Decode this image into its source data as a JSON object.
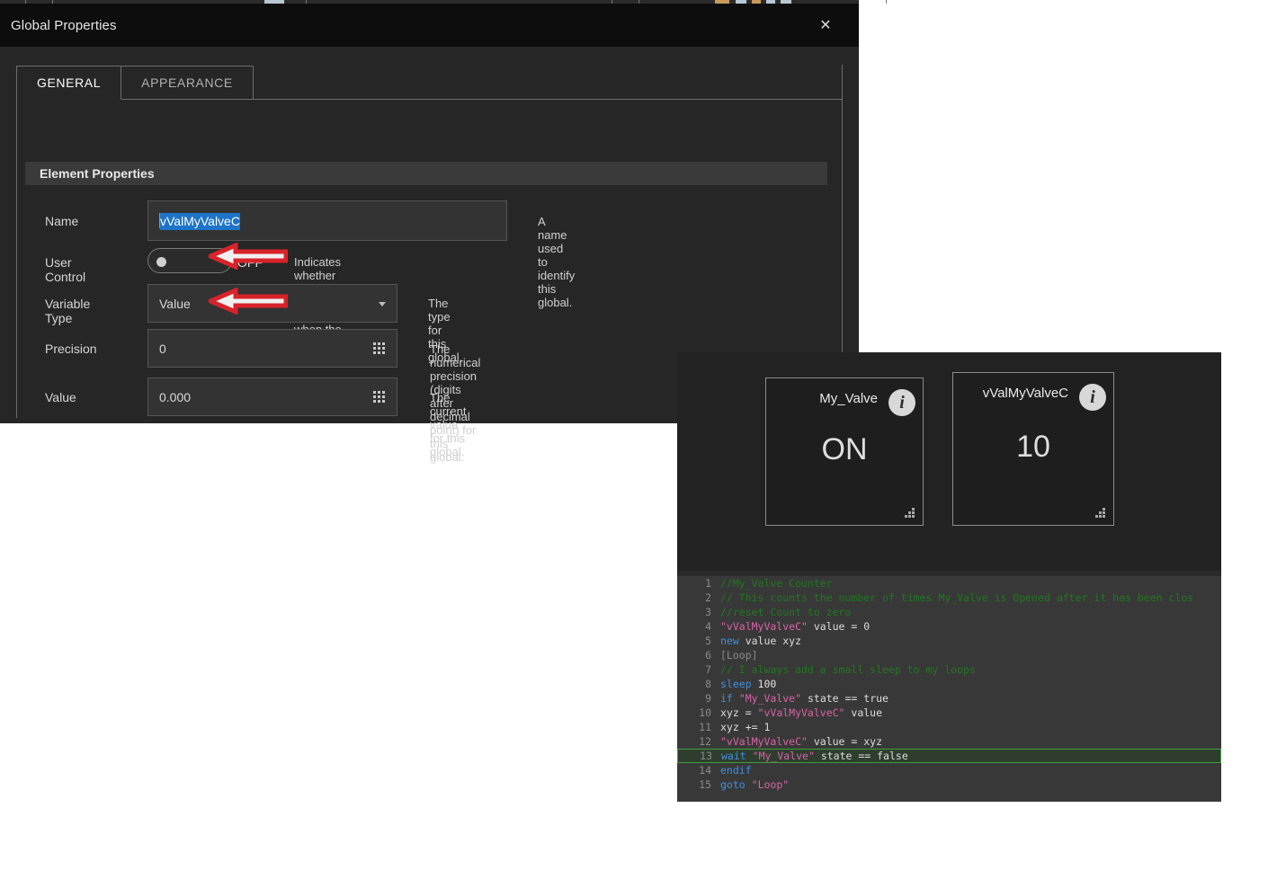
{
  "dialog": {
    "title": "Global Properties",
    "close_label": "✕",
    "tabs": [
      {
        "label": "GENERAL",
        "active": true
      },
      {
        "label": "APPEARANCE",
        "active": false
      }
    ],
    "section_title": "Element Properties",
    "fields": [
      {
        "label": "Name",
        "value": "vValMyValveC",
        "hint": "A name used to identify this global.",
        "type": "text-selected"
      },
      {
        "label": "User Control",
        "value": "OFF",
        "hint": "Indicates whether the user can edit the global when the application is locked.",
        "type": "toggle"
      },
      {
        "label": "Variable Type",
        "value": "Value",
        "hint": "The type for this global.",
        "type": "dropdown"
      },
      {
        "label": "Precision",
        "value": "0",
        "hint": "The numerical precision (digits after decimal point) for this global.",
        "type": "spinner"
      },
      {
        "label": "Value",
        "value": "0.000",
        "hint": "The current value for this global.",
        "type": "spinner"
      }
    ]
  },
  "annotations": [
    {
      "name": "variable-type-arrow",
      "points": "left"
    },
    {
      "name": "precision-arrow",
      "points": "left"
    }
  ],
  "runtime": {
    "widgets": [
      {
        "title": "My_Valve",
        "value": "ON",
        "info_glyph": "i"
      },
      {
        "title": "vValMyValveC",
        "value": "10",
        "info_glyph": "i"
      }
    ],
    "code": {
      "lines": [
        {
          "n": "1",
          "highlight": false,
          "tokens": [
            {
              "t": "//My_Valve Counter",
              "c": "com"
            }
          ]
        },
        {
          "n": "2",
          "highlight": false,
          "tokens": [
            {
              "t": "// This counts the number of times My_Valve is Opened after it has been clos",
              "c": "com"
            }
          ]
        },
        {
          "n": "3",
          "highlight": false,
          "tokens": [
            {
              "t": "//reset Count to zero",
              "c": "com"
            }
          ]
        },
        {
          "n": "4",
          "highlight": false,
          "tokens": [
            {
              "t": "\"vValMyValveC\"",
              "c": "str"
            },
            {
              "t": " value = 0",
              "c": "txt"
            }
          ]
        },
        {
          "n": "5",
          "highlight": false,
          "tokens": [
            {
              "t": "new",
              "c": "kw"
            },
            {
              "t": " value xyz",
              "c": "txt"
            }
          ]
        },
        {
          "n": "6",
          "highlight": false,
          "tokens": [
            {
              "t": "[Loop]",
              "c": "lbl"
            }
          ]
        },
        {
          "n": "7",
          "highlight": false,
          "tokens": [
            {
              "t": "// I always add a small sleep to my loops",
              "c": "com"
            }
          ]
        },
        {
          "n": "8",
          "highlight": false,
          "tokens": [
            {
              "t": "sleep",
              "c": "kw"
            },
            {
              "t": " 100",
              "c": "num"
            }
          ]
        },
        {
          "n": "9",
          "highlight": false,
          "tokens": [
            {
              "t": "if",
              "c": "kw"
            },
            {
              "t": " ",
              "c": "txt"
            },
            {
              "t": "\"My_Valve\"",
              "c": "str"
            },
            {
              "t": " state == true",
              "c": "txt"
            }
          ]
        },
        {
          "n": "10",
          "highlight": false,
          "tokens": [
            {
              "t": "xyz = ",
              "c": "txt"
            },
            {
              "t": "\"vValMyValveC\"",
              "c": "str"
            },
            {
              "t": " value",
              "c": "txt"
            }
          ]
        },
        {
          "n": "11",
          "highlight": false,
          "tokens": [
            {
              "t": "xyz += 1",
              "c": "txt"
            }
          ]
        },
        {
          "n": "12",
          "highlight": false,
          "tokens": [
            {
              "t": "\"vValMyValveC\"",
              "c": "str"
            },
            {
              "t": " value = xyz",
              "c": "txt"
            }
          ]
        },
        {
          "n": "13",
          "highlight": true,
          "tokens": [
            {
              "t": "wait",
              "c": "kw"
            },
            {
              "t": " ",
              "c": "txt"
            },
            {
              "t": "\"My_Valve\"",
              "c": "str"
            },
            {
              "t": " state == false",
              "c": "txt"
            }
          ]
        },
        {
          "n": "14",
          "highlight": false,
          "tokens": [
            {
              "t": "endif",
              "c": "kw"
            }
          ]
        },
        {
          "n": "15",
          "highlight": false,
          "tokens": [
            {
              "t": "goto",
              "c": "kw"
            },
            {
              "t": " ",
              "c": "txt"
            },
            {
              "t": "\"Loop\"",
              "c": "str"
            }
          ]
        }
      ]
    }
  },
  "colors": {
    "dialog_titlebar": "#0d0d0d",
    "dialog_body": "#262626",
    "field_bg": "#333333",
    "field_border": "#555555",
    "selection_blue": "#1d74c8",
    "annotation_red": "#d8232a",
    "code_bg": "#383838",
    "comment_green": "#1e7a1e",
    "keyword_blue": "#3f90e0",
    "string_pink": "#d963a8",
    "highlight_border": "#3f9f3f"
  }
}
